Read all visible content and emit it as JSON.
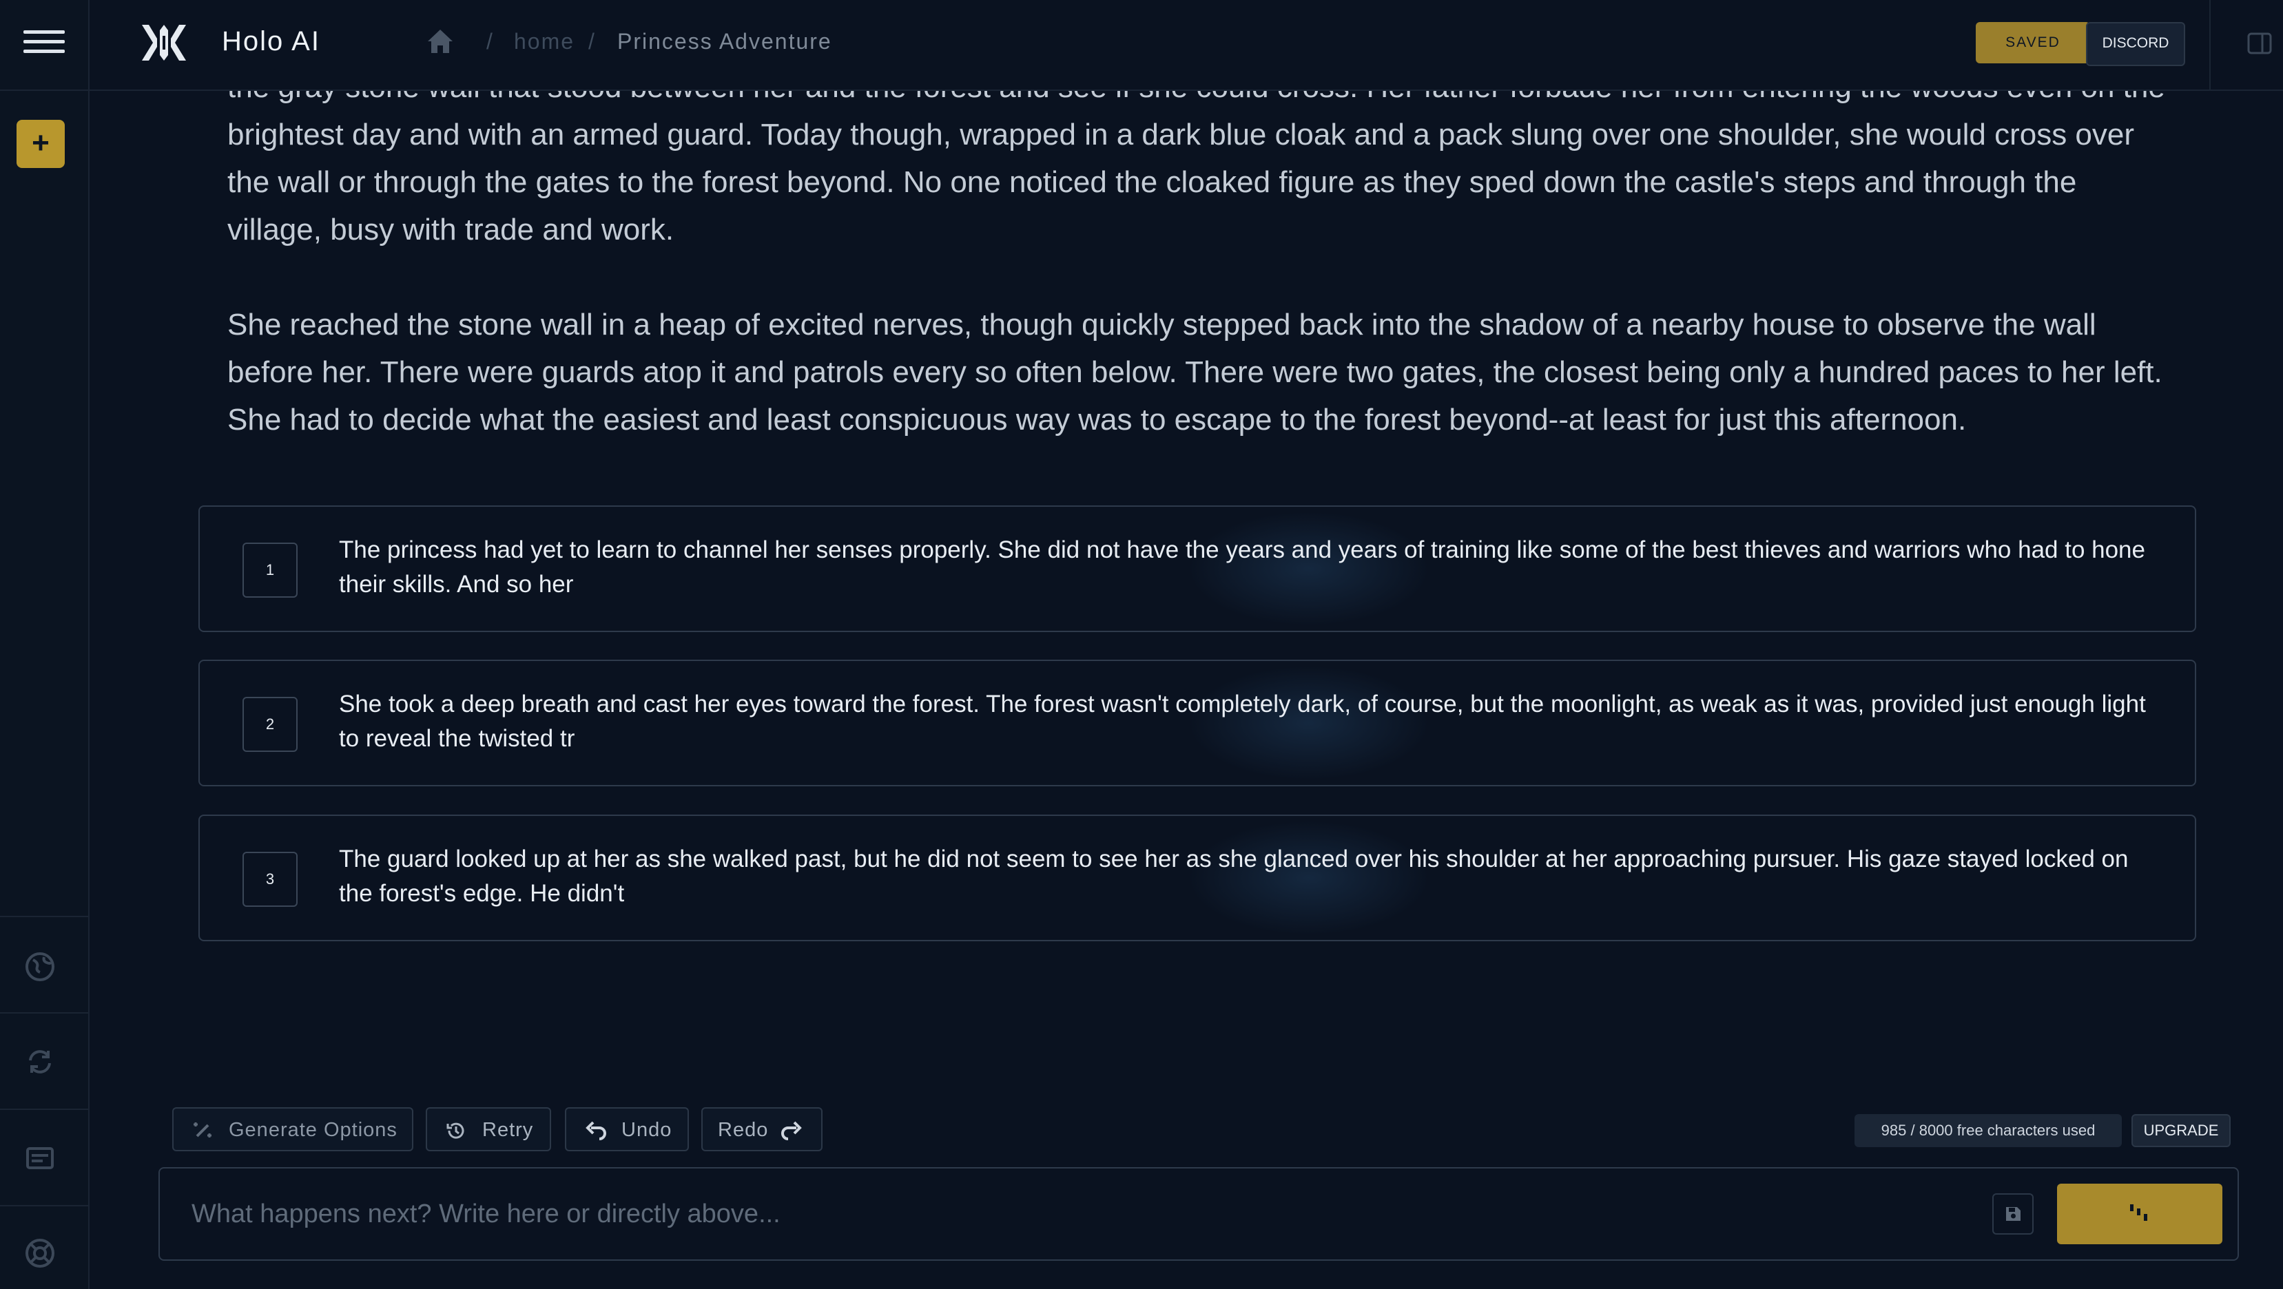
{
  "app": {
    "title": "Holo AI"
  },
  "breadcrumb": {
    "home": "home",
    "current": "Princess Adventure",
    "separator": "/"
  },
  "header": {
    "saved_label": "SAVED",
    "discord_label": "DISCORD"
  },
  "sidebar": {
    "add_label": "+",
    "icons": [
      "world-icon",
      "refresh-icon",
      "card-icon",
      "lifebuoy-icon"
    ]
  },
  "story": {
    "paragraphs": [
      "the gray stone wall that stood between her and the forest and see if she could cross. Her father forbade her from entering the woods even on the brightest day and with an armed guard. Today though, wrapped in a dark blue cloak and a pack slung over one shoulder, she would cross over the wall or through the gates to the forest beyond. No one noticed the cloaked figure as they sped down the castle's steps and through the village, busy with trade and work.",
      "She reached the stone wall in a heap of excited nerves, though quickly stepped back into the shadow of a nearby house to observe the wall before her. There were guards atop it and patrols every so often below. There were two gates, the closest being only a hundred paces to her left. She had to decide what the easiest and least conspicuous way was to escape to the forest beyond--at least for just this afternoon."
    ]
  },
  "options": [
    {
      "number": "1",
      "text": "The princess had yet to learn to channel her senses properly. She did not have the years and years of training like some of the best thieves and warriors who had to hone their skills. And so her"
    },
    {
      "number": "2",
      "text": "She took a deep breath and cast her eyes toward the forest. The forest wasn't completely dark, of course, but the moonlight, as weak as it was, provided just enough light to reveal the twisted tr"
    },
    {
      "number": "3",
      "text": "The guard looked up at her as she walked past, but he did not seem to see her as she glanced over his shoulder at her approaching pursuer. His gaze stayed locked on the forest's edge. He didn't"
    }
  ],
  "toolbar": {
    "generate_label": "Generate Options",
    "retry_label": "Retry",
    "undo_label": "Undo",
    "redo_label": "Redo",
    "char_count": "985 / 8000 free characters used",
    "upgrade_label": "UPGRADE"
  },
  "input": {
    "placeholder": "What happens next? Write here or directly above...",
    "value": ""
  },
  "colors": {
    "background": "#0a1220",
    "accent": "#b8972d",
    "border": "#2e3a4b"
  }
}
